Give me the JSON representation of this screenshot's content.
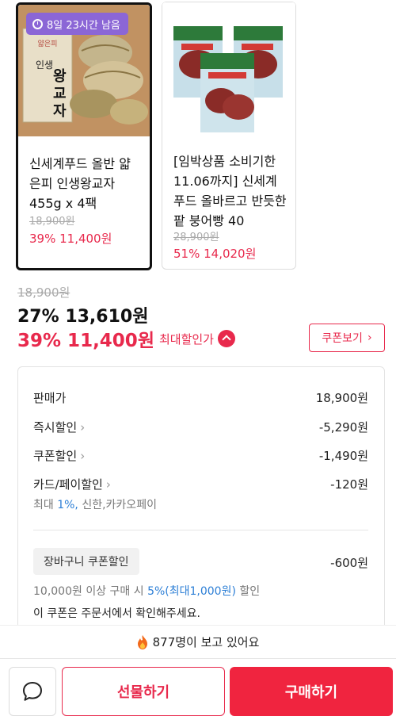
{
  "products": [
    {
      "timer": "8일 23시간 남음",
      "title": "신세계푸드 올반 얇은피 인생왕교자 455g x 4팩",
      "original_price": "18,900원",
      "price": "39% 11,400원"
    },
    {
      "title": "[임박상품 소비기한 11.06까지] 신세계푸드 올바르고 반듯한 팥 붕어빵 40",
      "original_price": "28,900원",
      "price": "51% 14,020원"
    }
  ],
  "pricing": {
    "original": "18,900원",
    "discount1": "27% 13,610원",
    "discount2": "39% 11,400원",
    "max_discount_label": "최대할인가",
    "coupon_button": "쿠폰보기"
  },
  "breakdown": {
    "sale_price_label": "판매가",
    "sale_price": "18,900원",
    "instant_label": "즉시할인",
    "instant": "-5,290원",
    "coupon_label": "쿠폰할인",
    "coupon": "-1,490원",
    "card_label": "카드/페이할인",
    "card": "-120원",
    "card_note_prefix": "최대 ",
    "card_note_pct": "1%,",
    "card_note_suffix": " 신한,카카오페이",
    "cart_label": "장바구니 쿠폰할인",
    "cart": "-600원",
    "cart_note_prefix": "10,000원 이상 구매 시 ",
    "cart_note_highlight": "5%(최대1,000원)",
    "cart_note_suffix": " 할인",
    "cart_note2": "이 쿠폰은 주문서에서 확인해주세요."
  },
  "viewing": "877명이 보고 있어요",
  "actions": {
    "gift": "선물하기",
    "buy": "구매하기"
  },
  "colors": {
    "accent": "#e8294c",
    "timer_badge": "#8b66d6",
    "link_blue": "#2d7fd6"
  }
}
